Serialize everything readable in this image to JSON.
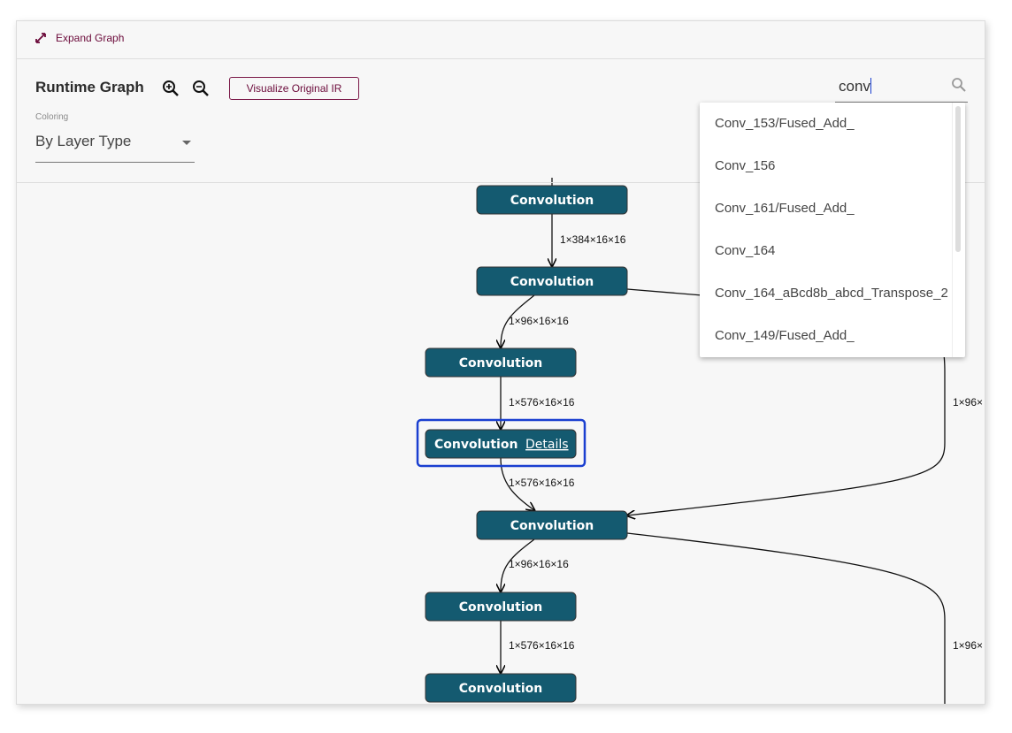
{
  "header": {
    "expand_label": "Expand Graph",
    "expand_icon": "expand-arrows-icon"
  },
  "toolbar": {
    "title": "Runtime Graph",
    "zoom_in_icon": "zoom-in-icon",
    "zoom_out_icon": "zoom-out-icon",
    "visualize_label": "Visualize Original IR"
  },
  "coloring": {
    "label": "Coloring",
    "value": "By Layer Type"
  },
  "search": {
    "value": "conv",
    "icon": "search-icon"
  },
  "dropdown": {
    "items": [
      "Conv_153/Fused_Add_",
      "Conv_156",
      "Conv_161/Fused_Add_",
      "Conv_164",
      "Conv_164_aBcd8b_abcd_Transpose_2",
      "Conv_149/Fused_Add_"
    ]
  },
  "graph": {
    "nodes": [
      "Convolution",
      "Convolution",
      "Convolution",
      "Convolution",
      "Convolution",
      "Convolution",
      "Convolution"
    ],
    "details_label": "Details",
    "edges": [
      "1×384×16×16",
      "1×96×16×16",
      "1×576×16×16",
      "1×576×16×16",
      "1×96×16×16",
      "1×576×16×16",
      "1×96×",
      "1×96×"
    ],
    "colors": {
      "node": "#145a70",
      "highlight": "#1a3fd0",
      "accent": "#6b0a3a"
    }
  }
}
